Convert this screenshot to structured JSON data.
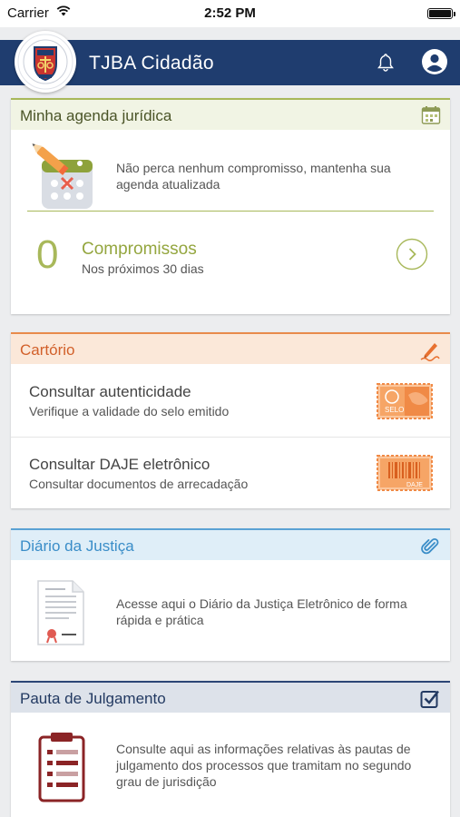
{
  "status_bar": {
    "carrier": "Carrier",
    "time": "2:52 PM"
  },
  "header": {
    "title": "TJBA Cidadão"
  },
  "agenda": {
    "title": "Minha agenda jurídica",
    "description": "Não perca nenhum compromisso, mantenha sua agenda atualizada",
    "count": "0",
    "label": "Compromissos",
    "sublabel": "Nos próximos 30 dias"
  },
  "cartorio": {
    "title": "Cartório",
    "items": [
      {
        "title": "Consultar autenticidade",
        "subtitle": "Verifique a validade do selo emitido",
        "badge": "SELO"
      },
      {
        "title": "Consultar DAJE eletrônico",
        "subtitle": "Consultar documentos de arrecadação",
        "badge": "DAJE"
      }
    ]
  },
  "diario": {
    "title": "Diário da Justiça",
    "description": "Acesse aqui o Diário da Justiça Eletrônico de forma rápida e prática"
  },
  "pauta": {
    "title": "Pauta de Julgamento",
    "description": "Consulte aqui as informações relativas às pautas de julgamento dos processos que tramitam no segundo grau de jurisdição"
  },
  "colors": {
    "header_bg": "#1f3d6f",
    "agenda_accent": "#a8b85a",
    "cartorio_accent": "#e88b4b",
    "diario_accent": "#5aa2d4",
    "pauta_accent": "#2c4676"
  }
}
